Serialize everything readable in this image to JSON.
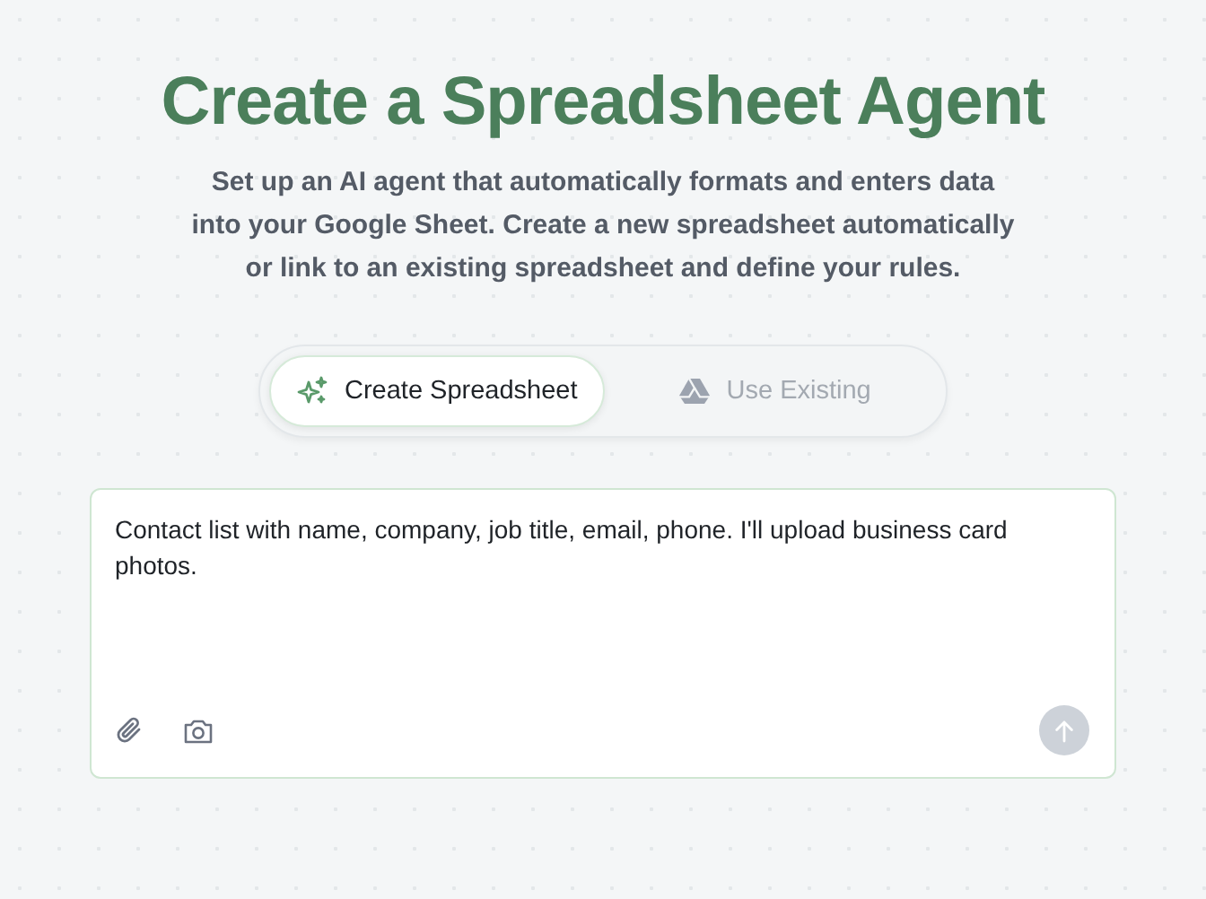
{
  "heading": "Create a Spreadsheet Agent",
  "description": "Set up an AI agent that automatically formats and enters data into your Google Sheet. Create a new spreadsheet automatically or link to an existing spreadsheet and define your rules.",
  "tabs": [
    {
      "label": "Create Spreadsheet",
      "selected": true
    },
    {
      "label": "Use Existing",
      "selected": false
    }
  ],
  "prompt": {
    "value": "Contact list with name, company, job title, email, phone. I'll upload business card photos.",
    "send_disabled": true
  }
}
